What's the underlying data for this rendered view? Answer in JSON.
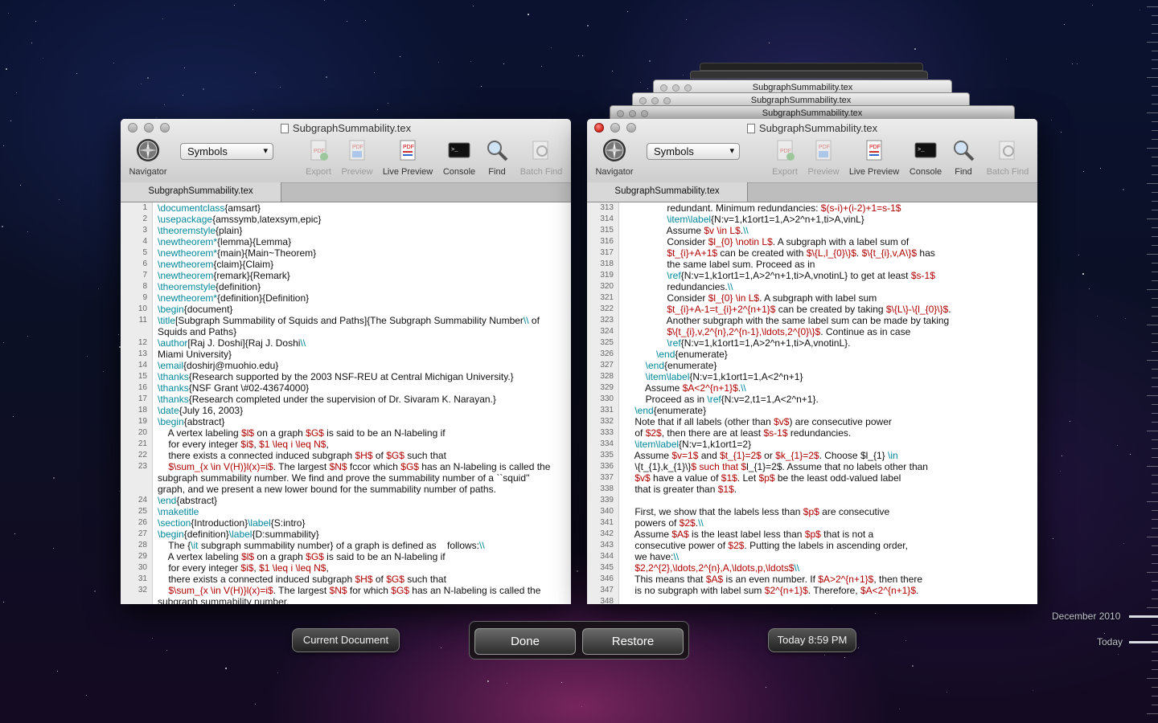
{
  "background_colors": {
    "accent": "#00a0b0",
    "dollar": "#b00000",
    "command": "#008899"
  },
  "left_window": {
    "title": "SubgraphSummability.tex",
    "tab": "SubgraphSummability.tex",
    "toolbar": {
      "navigator": "Navigator",
      "symbols": "Symbols",
      "export": "Export",
      "preview": "Preview",
      "live_preview": "Live Preview",
      "console": "Console",
      "find": "Find",
      "batch_find": "Batch Find"
    },
    "lines": [
      {
        "n": "1",
        "t": "\\documentclass{amsart}"
      },
      {
        "n": "2",
        "t": "\\usepackage{amssymb,latexsym,epic}"
      },
      {
        "n": "3",
        "t": "\\theoremstyle{plain}"
      },
      {
        "n": "4",
        "t": "\\newtheorem*{lemma}{Lemma}"
      },
      {
        "n": "5",
        "t": "\\newtheorem*{main}{Main~Theorem}"
      },
      {
        "n": "6",
        "t": "\\newtheorem{claim}{Claim}"
      },
      {
        "n": "7",
        "t": "\\newtheorem{remark}{Remark}"
      },
      {
        "n": "8",
        "t": "\\theoremstyle{definition}"
      },
      {
        "n": "9",
        "t": "\\newtheorem*{definition}{Definition}"
      },
      {
        "n": "10",
        "t": "\\begin{document}"
      },
      {
        "n": "11",
        "t": "\\title[Subgraph Summability of Squids and Paths]{The Subgraph Summability Number\\\\ of"
      },
      {
        "n": "",
        "t": "Squids and Paths}"
      },
      {
        "n": "12",
        "t": "\\author[Raj J. Doshi]{Raj J. Doshi\\\\"
      },
      {
        "n": "13",
        "t": "Miami University}"
      },
      {
        "n": "14",
        "t": "\\email{doshirj@muohio.edu}"
      },
      {
        "n": "15",
        "t": "\\thanks{Research supported by the 2003 NSF-REU at Central Michigan University.}"
      },
      {
        "n": "16",
        "t": "\\thanks{NSF Grant \\#02-43674000}"
      },
      {
        "n": "17",
        "t": "\\thanks{Research completed under the supervision of Dr. Sivaram K. Narayan.}"
      },
      {
        "n": "18",
        "t": "\\date{July 16, 2003}"
      },
      {
        "n": "19",
        "t": "\\begin{abstract}"
      },
      {
        "n": "20",
        "t": "    A vertex labeling $l$ on a graph $G$ is said to be an N-labeling if"
      },
      {
        "n": "21",
        "t": "    for every integer $i$, $1 \\leq i \\leq N$,"
      },
      {
        "n": "22",
        "t": "    there exists a connected induced subgraph $H$ of $G$ such that"
      },
      {
        "n": "23",
        "t": "    $\\sum_{x \\in V(H)}l(x)=i$. The largest $N$ fccor which $G$ has an N-labeling is called the"
      },
      {
        "n": "",
        "t": "subgraph summability number. We find and prove the summability number of a ``squid''"
      },
      {
        "n": "",
        "t": "graph, and we present a new lower bound for the summability number of paths."
      },
      {
        "n": "24",
        "t": "\\end{abstract}"
      },
      {
        "n": "25",
        "t": "\\maketitle"
      },
      {
        "n": "26",
        "t": "\\section{Introduction}\\label{S:intro}"
      },
      {
        "n": "27",
        "t": "\\begin{definition}\\label{D:summability}"
      },
      {
        "n": "28",
        "t": "    The {\\it subgraph summability number} of a graph is defined as    follows:\\\\"
      },
      {
        "n": "29",
        "t": "    A vertex labeling $l$ on a graph $G$ is said to be an N-labeling if"
      },
      {
        "n": "30",
        "t": "    for every integer $i$, $1 \\leq i \\leq N$,"
      },
      {
        "n": "31",
        "t": "    there exists a connected induced subgraph $H$ of $G$ such that"
      },
      {
        "n": "32",
        "t": "    $\\sum_{x \\in V(H)}l(x)=i$. The largest $N$ for which $G$ has an N-labeling is called the"
      },
      {
        "n": "",
        "t": "subgraph summability number."
      }
    ]
  },
  "right_window": {
    "title": "SubgraphSummability.tex",
    "tab": "SubgraphSummability.tex",
    "ghost_titles": [
      "SubgraphSummability.tex",
      "SubgraphSummability.tex",
      "SubgraphSummability.tex"
    ],
    "toolbar": {
      "navigator": "Navigator",
      "symbols": "Symbols",
      "export": "Export",
      "preview": "Preview",
      "live_preview": "Live Preview",
      "console": "Console",
      "find": "Find",
      "batch_find": "Batch Find"
    },
    "lines": [
      {
        "n": "313",
        "t": "                redundant. Minimum redundancies: $(s-i)+(i-2)+1=s-1$"
      },
      {
        "n": "314",
        "t": "                \\item\\label{N:v=1,k1ort1=1,A>2^n+1,ti>A,vinL}"
      },
      {
        "n": "315",
        "t": "                Assume $v \\in L$.\\\\"
      },
      {
        "n": "316",
        "t": "                Consider $l_{0} \\notin L$. A subgraph with a label sum of"
      },
      {
        "n": "317",
        "t": "                $t_{i}+A+1$ can be created with $\\{L,l_{0}\\}$. $\\{t_{i},v,A\\}$ has"
      },
      {
        "n": "318",
        "t": "                the same label sum. Proceed as in"
      },
      {
        "n": "319",
        "t": "                \\ref{N:v=1,k1ort1=1,A>2^n+1,ti>A,vnotinL} to get at least $s-1$"
      },
      {
        "n": "320",
        "t": "                redundancies.\\\\"
      },
      {
        "n": "321",
        "t": "                Consider $l_{0} \\in L$. A subgraph with label sum"
      },
      {
        "n": "322",
        "t": "                $t_{i}+A-1=t_{i}+2^{n+1}$ can be created by taking $\\{L\\}-\\{l_{0}\\}$."
      },
      {
        "n": "323",
        "t": "                Another subgraph with the same label sum can be made by taking"
      },
      {
        "n": "324",
        "t": "                $\\{t_{i},v,2^{n},2^{n-1},\\ldots,2^{0}\\}$. Continue as in case"
      },
      {
        "n": "325",
        "t": "                \\ref{N:v=1,k1ort1=1,A>2^n+1,ti>A,vnotinL}."
      },
      {
        "n": "326",
        "t": "            \\end{enumerate}"
      },
      {
        "n": "327",
        "t": "        \\end{enumerate}"
      },
      {
        "n": "328",
        "t": "        \\item\\label{N:v=1,k1ort1=1,A<2^n+1}"
      },
      {
        "n": "329",
        "t": "        Assume $A<2^{n+1}$.\\\\"
      },
      {
        "n": "330",
        "t": "        Proceed as in \\ref{N:v=2,t1=1,A<2^n+1}."
      },
      {
        "n": "331",
        "t": "    \\end{enumerate}"
      },
      {
        "n": "332",
        "t": "    Note that if all labels (other than $v$) are consecutive power"
      },
      {
        "n": "333",
        "t": "    of $2$, then there are at least $s-1$ redundancies."
      },
      {
        "n": "334",
        "t": "    \\item\\label{N:v=1,k1ort1=2}"
      },
      {
        "n": "335",
        "t": "    Assume $v=1$ and $t_{1}=2$ or $k_{1}=2$. Choose $l_{1} \\in"
      },
      {
        "n": "336",
        "t": "    \\{t_{1},k_{1}\\}$ such that $l_{1}=2$. Assume that no labels other than"
      },
      {
        "n": "337",
        "t": "    $v$ have a value of $1$. Let $p$ be the least odd-valued label"
      },
      {
        "n": "338",
        "t": "    that is greater than $1$."
      },
      {
        "n": "339",
        "t": ""
      },
      {
        "n": "340",
        "t": "    First, we show that the labels less than $p$ are consecutive"
      },
      {
        "n": "341",
        "t": "    powers of $2$.\\\\"
      },
      {
        "n": "342",
        "t": "    Assume $A$ is the least label less than $p$ that is not a"
      },
      {
        "n": "343",
        "t": "    consecutive power of $2$. Putting the labels in ascending order,"
      },
      {
        "n": "344",
        "t": "    we have:\\\\"
      },
      {
        "n": "345",
        "t": "    $2,2^{2},\\ldots,2^{n},A,\\ldots,p,\\ldots$\\\\"
      },
      {
        "n": "346",
        "t": "    This means that $A$ is an even number. If $A>2^{n+1}$, then there"
      },
      {
        "n": "347",
        "t": "    is no subgraph with label sum $2^{n+1}$. Therefore, $A<2^{n+1}$."
      },
      {
        "n": "348",
        "t": ""
      }
    ]
  },
  "bottom_bar": {
    "current_document": "Current Document",
    "done": "Done",
    "restore": "Restore",
    "timestamp": "Today 8:59 PM"
  },
  "timeline": {
    "label_top": "December 2010",
    "label_bottom": "Today"
  }
}
